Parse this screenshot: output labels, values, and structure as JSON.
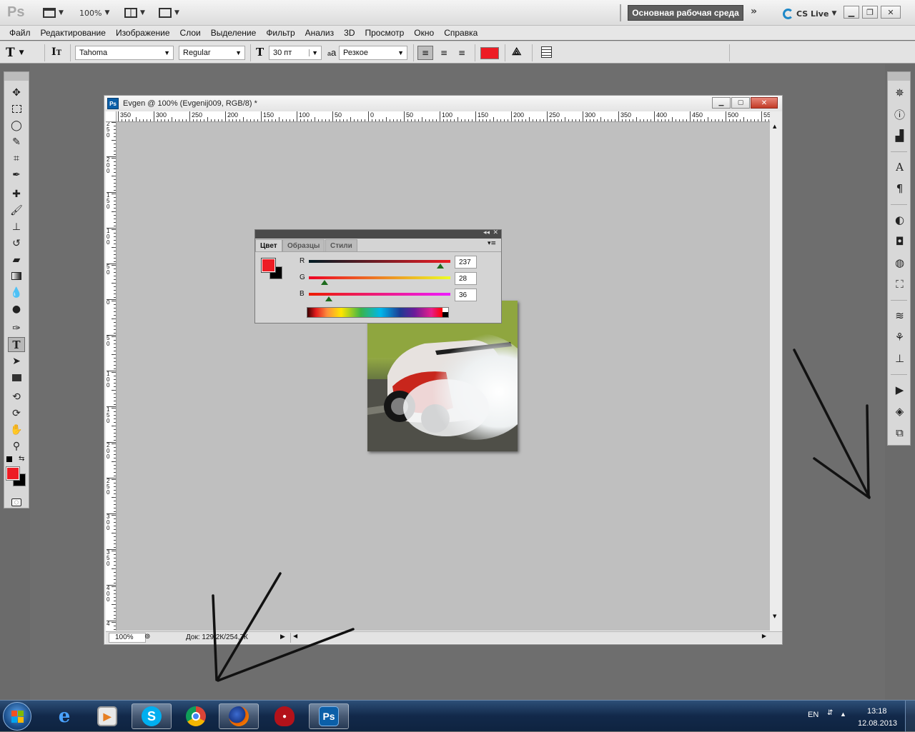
{
  "app": {
    "logo": "Ps",
    "zoom": "100%",
    "workspace": "Основная рабочая среда",
    "cs_live": "CS Live"
  },
  "menu": [
    "Файл",
    "Редактирование",
    "Изображение",
    "Слои",
    "Выделение",
    "Фильтр",
    "Анализ",
    "3D",
    "Просмотр",
    "Окно",
    "Справка"
  ],
  "options": {
    "tool_glyph": "T",
    "font_family": "Tahoma",
    "font_style": "Regular",
    "font_size": "30 пт",
    "aa_label": "a",
    "antialias": "Резкое",
    "text_color": "#ed1c24"
  },
  "document": {
    "title": "Evgen @ 100% (Evgenij009, RGB/8) *",
    "hruler_labels": [
      "350",
      "300",
      "250",
      "200",
      "150",
      "100",
      "50",
      "0",
      "50",
      "100",
      "150",
      "200",
      "250",
      "300",
      "350",
      "400",
      "450",
      "500",
      "55"
    ],
    "vruler_labels": [
      "2 5 0",
      "2 0 0",
      "1 5 0",
      "1 0 0",
      "5 0",
      "0",
      "5 0",
      "1 0 0",
      "1 5 0",
      "2 0 0",
      "2 5 0",
      "3 0 0",
      "3 5 0",
      "4 0 0",
      "4"
    ],
    "zoom": "100%",
    "doc_info": "Док: 129,2К/254,7К"
  },
  "color_panel": {
    "tabs": [
      "Цвет",
      "Образцы",
      "Стили"
    ],
    "fg_color": "#ed1c24",
    "bg_color": "#000000",
    "r_label": "R",
    "r_value": "237",
    "g_label": "G",
    "g_value": "28",
    "b_label": "B",
    "b_value": "36"
  },
  "tools": {
    "fg_color": "#ed1c24",
    "bg_color": "#000000"
  },
  "taskbar": {
    "lang": "EN",
    "time": "13:18",
    "date": "12.08.2013"
  }
}
